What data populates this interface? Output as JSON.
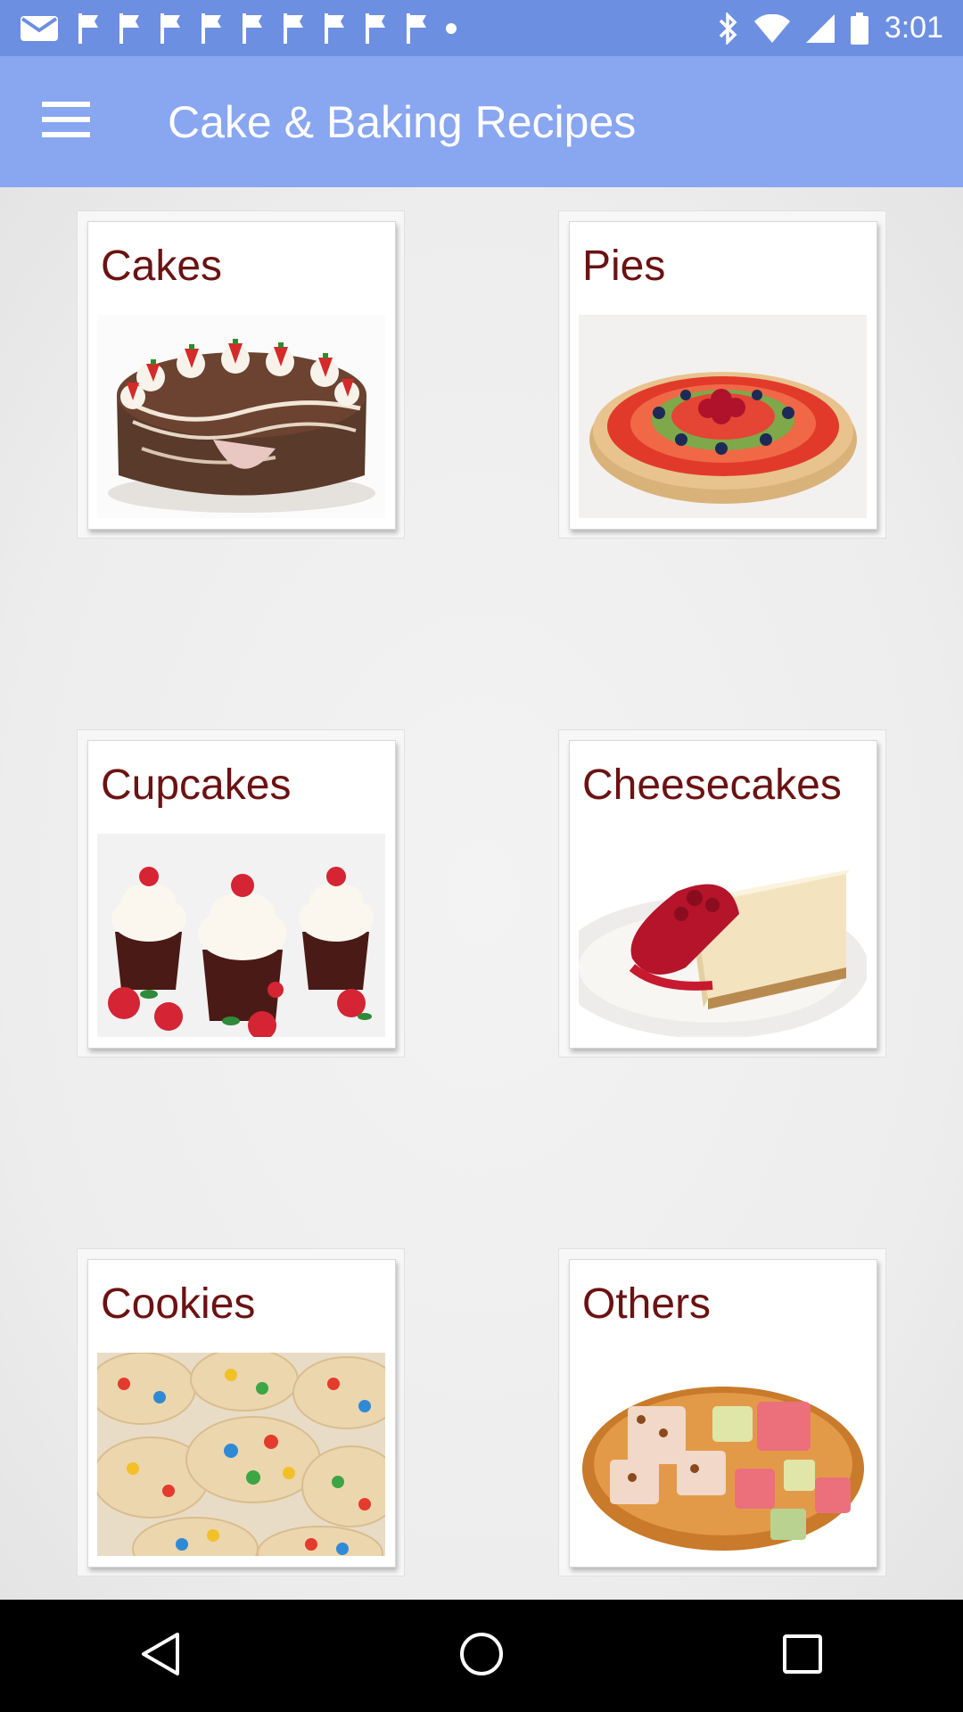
{
  "status_bar": {
    "time": "3:01",
    "notification_icons": [
      "mail-icon",
      "flag-icon",
      "flag-icon",
      "flag-icon",
      "flag-icon",
      "flag-icon",
      "flag-icon",
      "flag-icon",
      "flag-icon",
      "flag-icon",
      "dot-icon"
    ],
    "system_icons": [
      "bluetooth-icon",
      "wifi-icon",
      "signal-icon",
      "battery-icon"
    ]
  },
  "app_bar": {
    "title": "Cake & Baking Recipes",
    "menu_icon": "hamburger-menu-icon"
  },
  "colors": {
    "status_bar": "#6d8fe2",
    "app_bar": "#89a6f0",
    "label_text": "#6b1212",
    "background": "#efefef"
  },
  "categories": [
    {
      "label": "Cakes",
      "image": "chocolate-strawberry-cake"
    },
    {
      "label": "Pies",
      "image": "fruit-tart"
    },
    {
      "label": "Cupcakes",
      "image": "rose-cupcakes"
    },
    {
      "label": "Cheesecakes",
      "image": "cheesecake-slice"
    },
    {
      "label": "Cookies",
      "image": "candy-cookies"
    },
    {
      "label": "Others",
      "image": "turkish-delight-plate"
    }
  ],
  "nav_bar": {
    "buttons": [
      "back-icon",
      "home-icon",
      "recents-icon"
    ]
  }
}
